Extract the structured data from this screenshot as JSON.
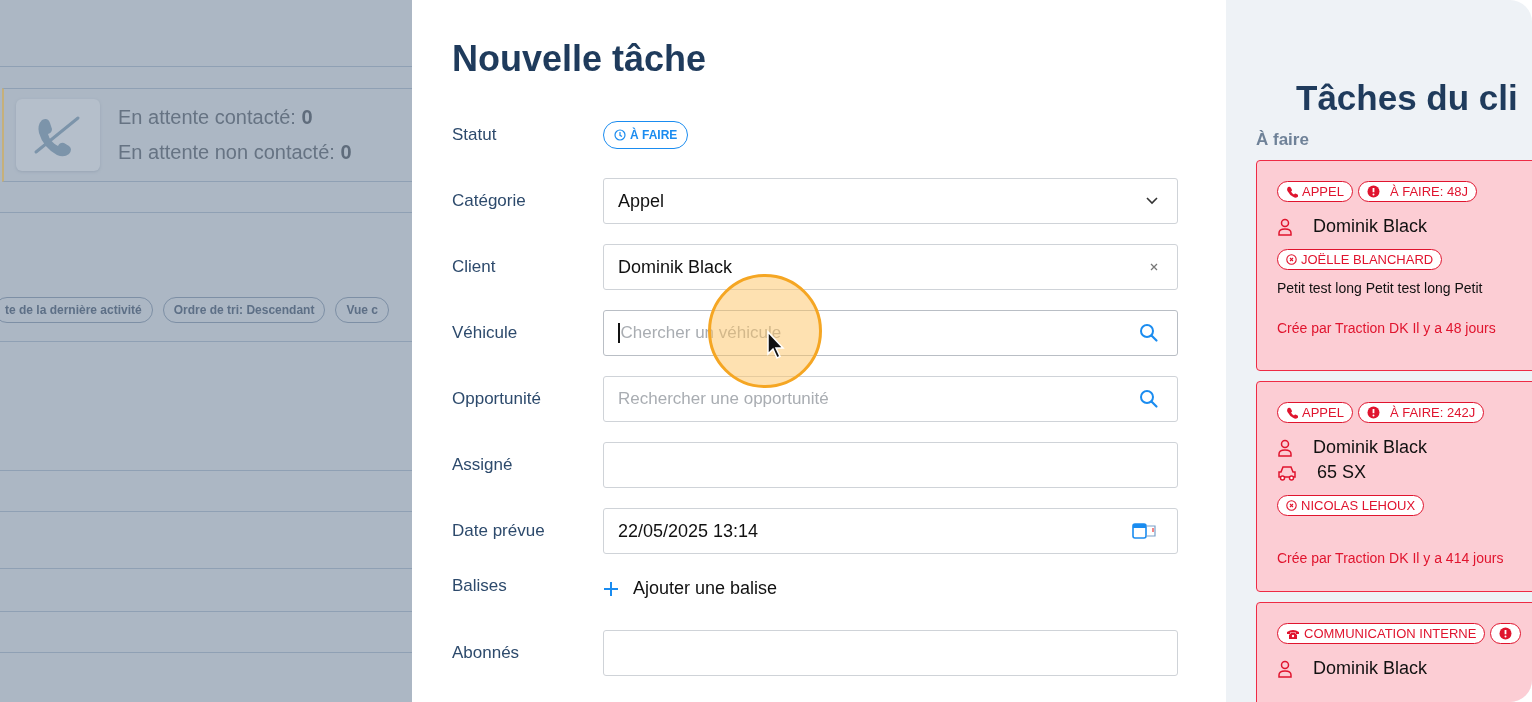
{
  "background": {
    "stats": [
      {
        "label": "En attente contacté:",
        "value": "0"
      },
      {
        "label": "En attente non contacté:",
        "value": "0"
      }
    ],
    "filter_chips": [
      "te de la dernière activité",
      "Ordre de tri: Descendant",
      "Vue c"
    ]
  },
  "form": {
    "title": "Nouvelle tâche",
    "fields": [
      {
        "kind": "status",
        "label": "Statut",
        "value": "À FAIRE"
      },
      {
        "kind": "select",
        "label": "Catégorie",
        "value": "Appel"
      },
      {
        "kind": "clearable",
        "label": "Client",
        "value": "Dominik Black"
      },
      {
        "kind": "search",
        "label": "Véhicule",
        "placeholder": "Chercher un véhicule",
        "focused": true
      },
      {
        "kind": "search",
        "label": "Opportunité",
        "placeholder": "Rechercher une opportunité",
        "focused": false
      },
      {
        "kind": "text",
        "label": "Assigné"
      },
      {
        "kind": "date",
        "label": "Date prévue",
        "value": "22/05/2025 13:14"
      },
      {
        "kind": "tags",
        "label": "Balises",
        "action": "Ajouter une balise"
      },
      {
        "kind": "text",
        "label": "Abonnés"
      }
    ]
  },
  "client_tasks": {
    "title": "Tâches du cli",
    "section": "À faire",
    "cards": [
      {
        "tags": [
          {
            "kind": "call",
            "text": "APPEL"
          },
          {
            "kind": "due",
            "text": "À FAIRE: 48J"
          }
        ],
        "client": "Dominik Black",
        "assignee": "JOËLLE BLANCHARD",
        "description": "Petit test long Petit test long Petit",
        "footer": "Crée par Traction DK Il y a 48 jours"
      },
      {
        "tags": [
          {
            "kind": "call",
            "text": "APPEL"
          },
          {
            "kind": "due",
            "text": "À FAIRE: 242J"
          }
        ],
        "client": "Dominik Black",
        "vehicle": "65 SX",
        "assignee": "NICOLAS LEHOUX",
        "footer": "Crée par Traction DK Il y a 414 jours"
      },
      {
        "tags": [
          {
            "kind": "internal",
            "text": "COMMUNICATION INTERNE"
          },
          {
            "kind": "due"
          }
        ],
        "client": "Dominik Black"
      }
    ]
  }
}
